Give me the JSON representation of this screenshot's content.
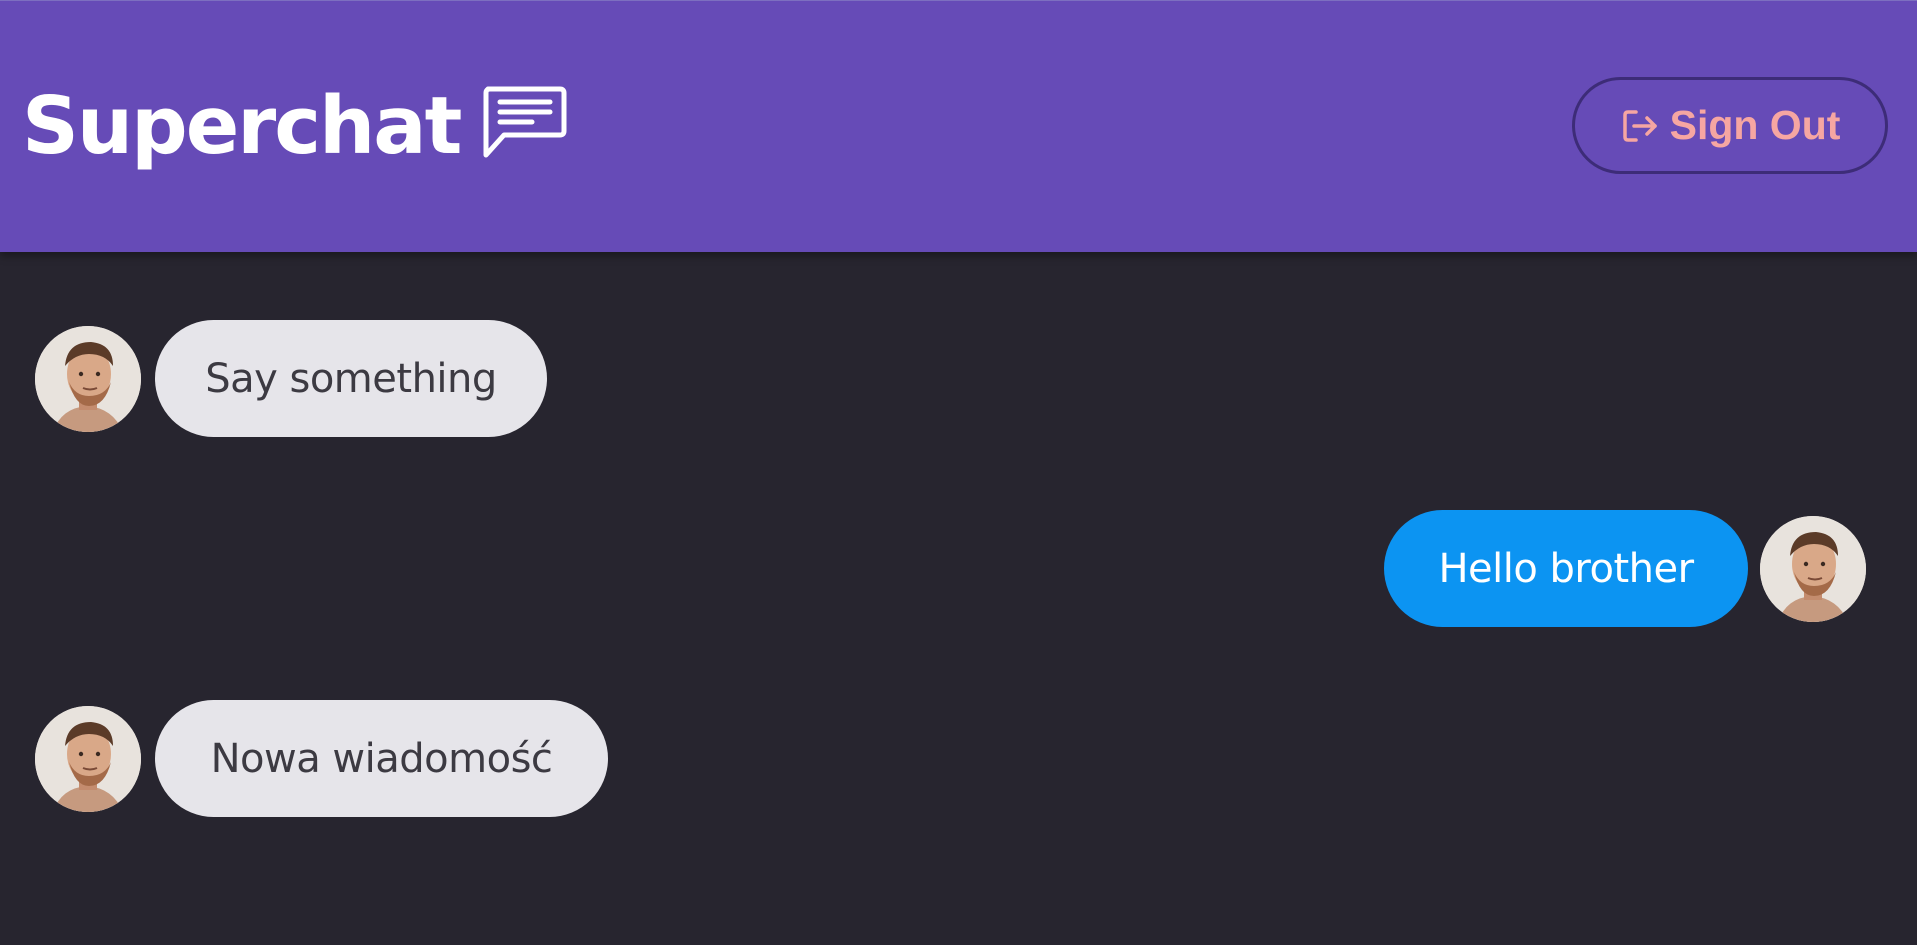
{
  "header": {
    "title": "Superchat",
    "icon": "chat-bubble-icon",
    "background": "#664bb7",
    "sign_out": {
      "label": "Sign Out",
      "icon": "sign-out-icon",
      "color": "#f6a6a2"
    }
  },
  "messages": [
    {
      "text": "Say something",
      "direction": "received",
      "avatar": "avatar"
    },
    {
      "text": "Hello brother",
      "direction": "sent",
      "avatar": "avatar"
    },
    {
      "text": "Nowa wiadomość",
      "direction": "received",
      "avatar": "avatar"
    }
  ],
  "colors": {
    "background": "#27252f",
    "received_bubble": "#e6e5ea",
    "sent_bubble": "#0c94f2"
  }
}
